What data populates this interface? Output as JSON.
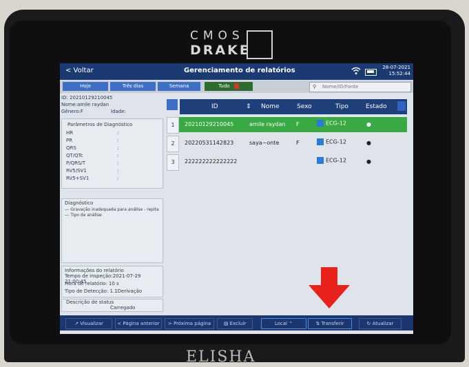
{
  "brand": {
    "top_line1": "CMOS",
    "top_line2": "DRAKE",
    "bottom": "ELISHA"
  },
  "topbar": {
    "back": "< Voltar",
    "title": "Gerenciamento de relatórios",
    "date": "28-07-2021",
    "time": "15:52:44"
  },
  "tabs": [
    "Hoje",
    "Três dias",
    "Semana",
    "Tudo"
  ],
  "search": {
    "placeholder": "Nome/ID/Fonte"
  },
  "patient": {
    "id": "ID: 20210129210045",
    "name": "Nome:amile raydan",
    "gender": "Gênero:F",
    "age": "Idade:"
  },
  "params": {
    "title": "Parâmetros de Diagnóstico",
    "rows": [
      {
        "label": "HR",
        "value": ":"
      },
      {
        "label": "PR",
        "value": ":"
      },
      {
        "label": "QRS",
        "value": ":"
      },
      {
        "label": "QT/QTc",
        "value": ":"
      },
      {
        "label": "P/QRS/T",
        "value": ":"
      },
      {
        "label": "RV5/SV1",
        "value": ":"
      },
      {
        "label": "RV5+SV1",
        "value": ":"
      }
    ]
  },
  "diagnosis": {
    "title": "Diagnóstico",
    "text": "--- Gravação inadequada para análise - repita --- Tipo de análise"
  },
  "info": {
    "title": "Informações do relatório",
    "inspection": "Tempo de inspeção:2021-07-29 21:00:45",
    "report_time": "Hora de relatório: 10 s",
    "capture_type": "Tipo de Detecção: 1.1Derivação"
  },
  "status": {
    "title": "Descrição de status",
    "value": "Carregado"
  },
  "table": {
    "headers": [
      "ID",
      "Nome",
      "Sexo",
      "Tipo",
      "Estado"
    ],
    "rows": [
      {
        "n": "1",
        "id": "20210129210045",
        "name": "amile raydan",
        "sex": "F",
        "type": "ECG-12",
        "selected": true
      },
      {
        "n": "2",
        "id": "20220531142823",
        "name": "saya~onte",
        "sex": "F",
        "type": "ECG-12",
        "selected": false
      },
      {
        "n": "3",
        "id": "222222222222222",
        "name": "",
        "sex": "",
        "type": "ECG-12",
        "selected": false
      }
    ]
  },
  "bottom": {
    "view": "Visualizar",
    "prev": "< Página anterior",
    "next": "> Próxima página",
    "delete": "Excluir",
    "local": "Local",
    "transfer": "Transferir",
    "update": "Atualizar"
  },
  "colors": {
    "topbar": "#1b3a72",
    "selected_row": "#3aa843",
    "arrow": "#e8211d",
    "delete_tab": "#2f6a2f"
  }
}
